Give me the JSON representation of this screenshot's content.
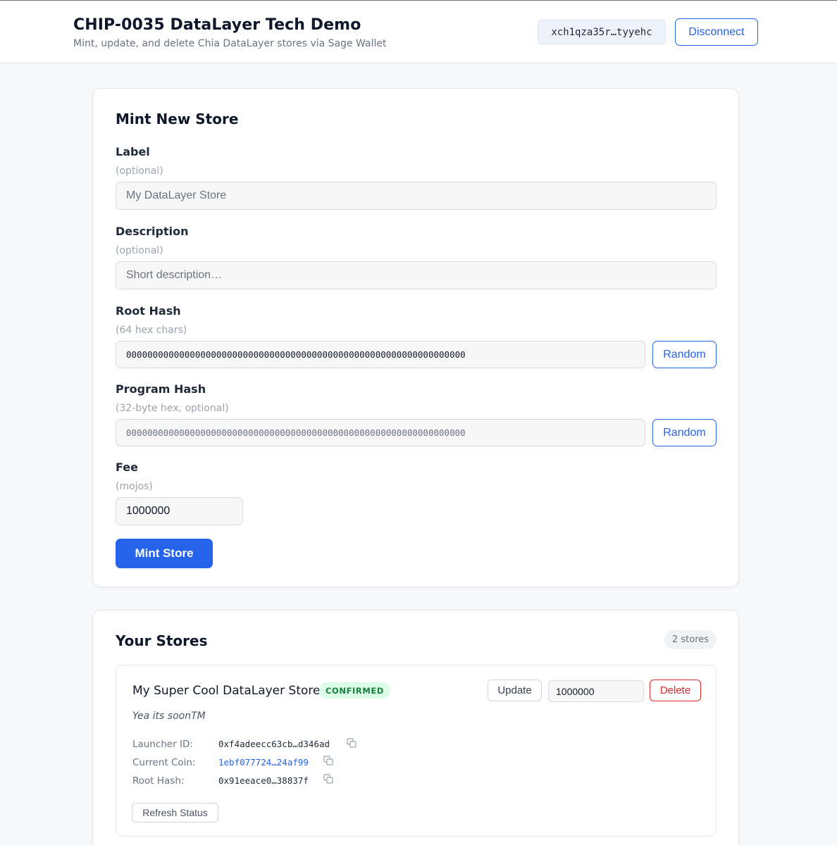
{
  "header": {
    "title": "CHIP-0035 DataLayer Tech Demo",
    "subtitle": "Mint, update, and delete Chia DataLayer stores via Sage Wallet",
    "wallet_address": "xch1qza35r…tyyehc",
    "disconnect_label": "Disconnect"
  },
  "mint": {
    "title": "Mint New Store",
    "label": {
      "label": "Label",
      "hint": "(optional)",
      "placeholder": "My DataLayer Store"
    },
    "description": {
      "label": "Description",
      "hint": "(optional)",
      "placeholder": "Short description…"
    },
    "root_hash": {
      "label": "Root Hash",
      "hint": "(64 hex chars)",
      "value": "0000000000000000000000000000000000000000000000000000000000000000",
      "random_label": "Random"
    },
    "program_hash": {
      "label": "Program Hash",
      "hint": "(32-byte hex, optional)",
      "value": "0000000000000000000000000000000000000000000000000000000000000000",
      "random_label": "Random"
    },
    "fee": {
      "label": "Fee",
      "hint": "(mojos)",
      "value": "1000000"
    },
    "submit_label": "Mint Store"
  },
  "stores": {
    "title": "Your Stores",
    "count_label": "2 stores",
    "items": [
      {
        "name": "My Super Cool DataLayer Store",
        "status": "CONFIRMED",
        "description": "Yea its soonTM",
        "update_label": "Update",
        "fee_value": "1000000",
        "delete_label": "Delete",
        "launcher_id_label": "Launcher ID:",
        "launcher_id": "0xf4adeecc63cb…d346ad",
        "current_coin_label": "Current Coin:",
        "current_coin": "1ebf077724…24af99",
        "root_hash_label": "Root Hash:",
        "root_hash": "0x91eeace0…38837f",
        "refresh_label": "Refresh Status"
      }
    ]
  },
  "colors": {
    "primary": "#2563eb",
    "danger": "#dc2626",
    "success_bg": "#dcfce7",
    "success_text": "#15803d",
    "page_bg": "#f7f8fa"
  },
  "icons": {
    "copy": "copy-icon"
  }
}
